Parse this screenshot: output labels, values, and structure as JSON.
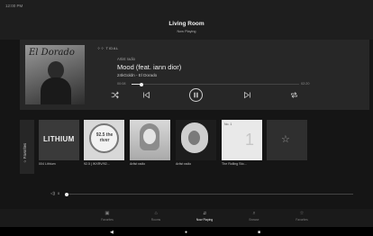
{
  "status_bar": {
    "time": "12:00 PM"
  },
  "header": {
    "room": "Living Room",
    "subtitle": "Now Playing"
  },
  "now_playing": {
    "service": "TIDAL",
    "album_brand": "El Dorado",
    "source_label": "Artist radio",
    "title": "Mood (feat. iann dior)",
    "artist_album": "24kGoldn - El Dorado",
    "elapsed": "00:08",
    "duration": "02:20",
    "progress_fraction": 0.06
  },
  "favorites": {
    "rail_label": "Favorites",
    "items": [
      {
        "caption": "004 Lithium",
        "art_text": "LITHIUM"
      },
      {
        "caption": "92.5 | WXRV/92...",
        "art_text": "92.5 the river"
      },
      {
        "caption": "Artist radio",
        "art_text": ""
      },
      {
        "caption": "Artist radio",
        "art_text": ""
      },
      {
        "caption": "The Rolling Sto...",
        "art_text": "No. 1"
      }
    ]
  },
  "volume": {
    "value": "0",
    "level_fraction": 0.0
  },
  "tabs": [
    {
      "label": "Favorites",
      "icon": "calendar-icon",
      "active": false
    },
    {
      "label": "Rooms",
      "icon": "home-icon",
      "active": false
    },
    {
      "label": "Now Playing",
      "icon": "music-note-icon",
      "active": true
    },
    {
      "label": "Browse",
      "icon": "search-icon",
      "active": false
    },
    {
      "label": "Favorites",
      "icon": "star-icon",
      "active": false
    }
  ],
  "colors": {
    "background": "#151515",
    "card": "#272727",
    "accent": "#f0f0f0",
    "muted": "#7d7d7d"
  }
}
